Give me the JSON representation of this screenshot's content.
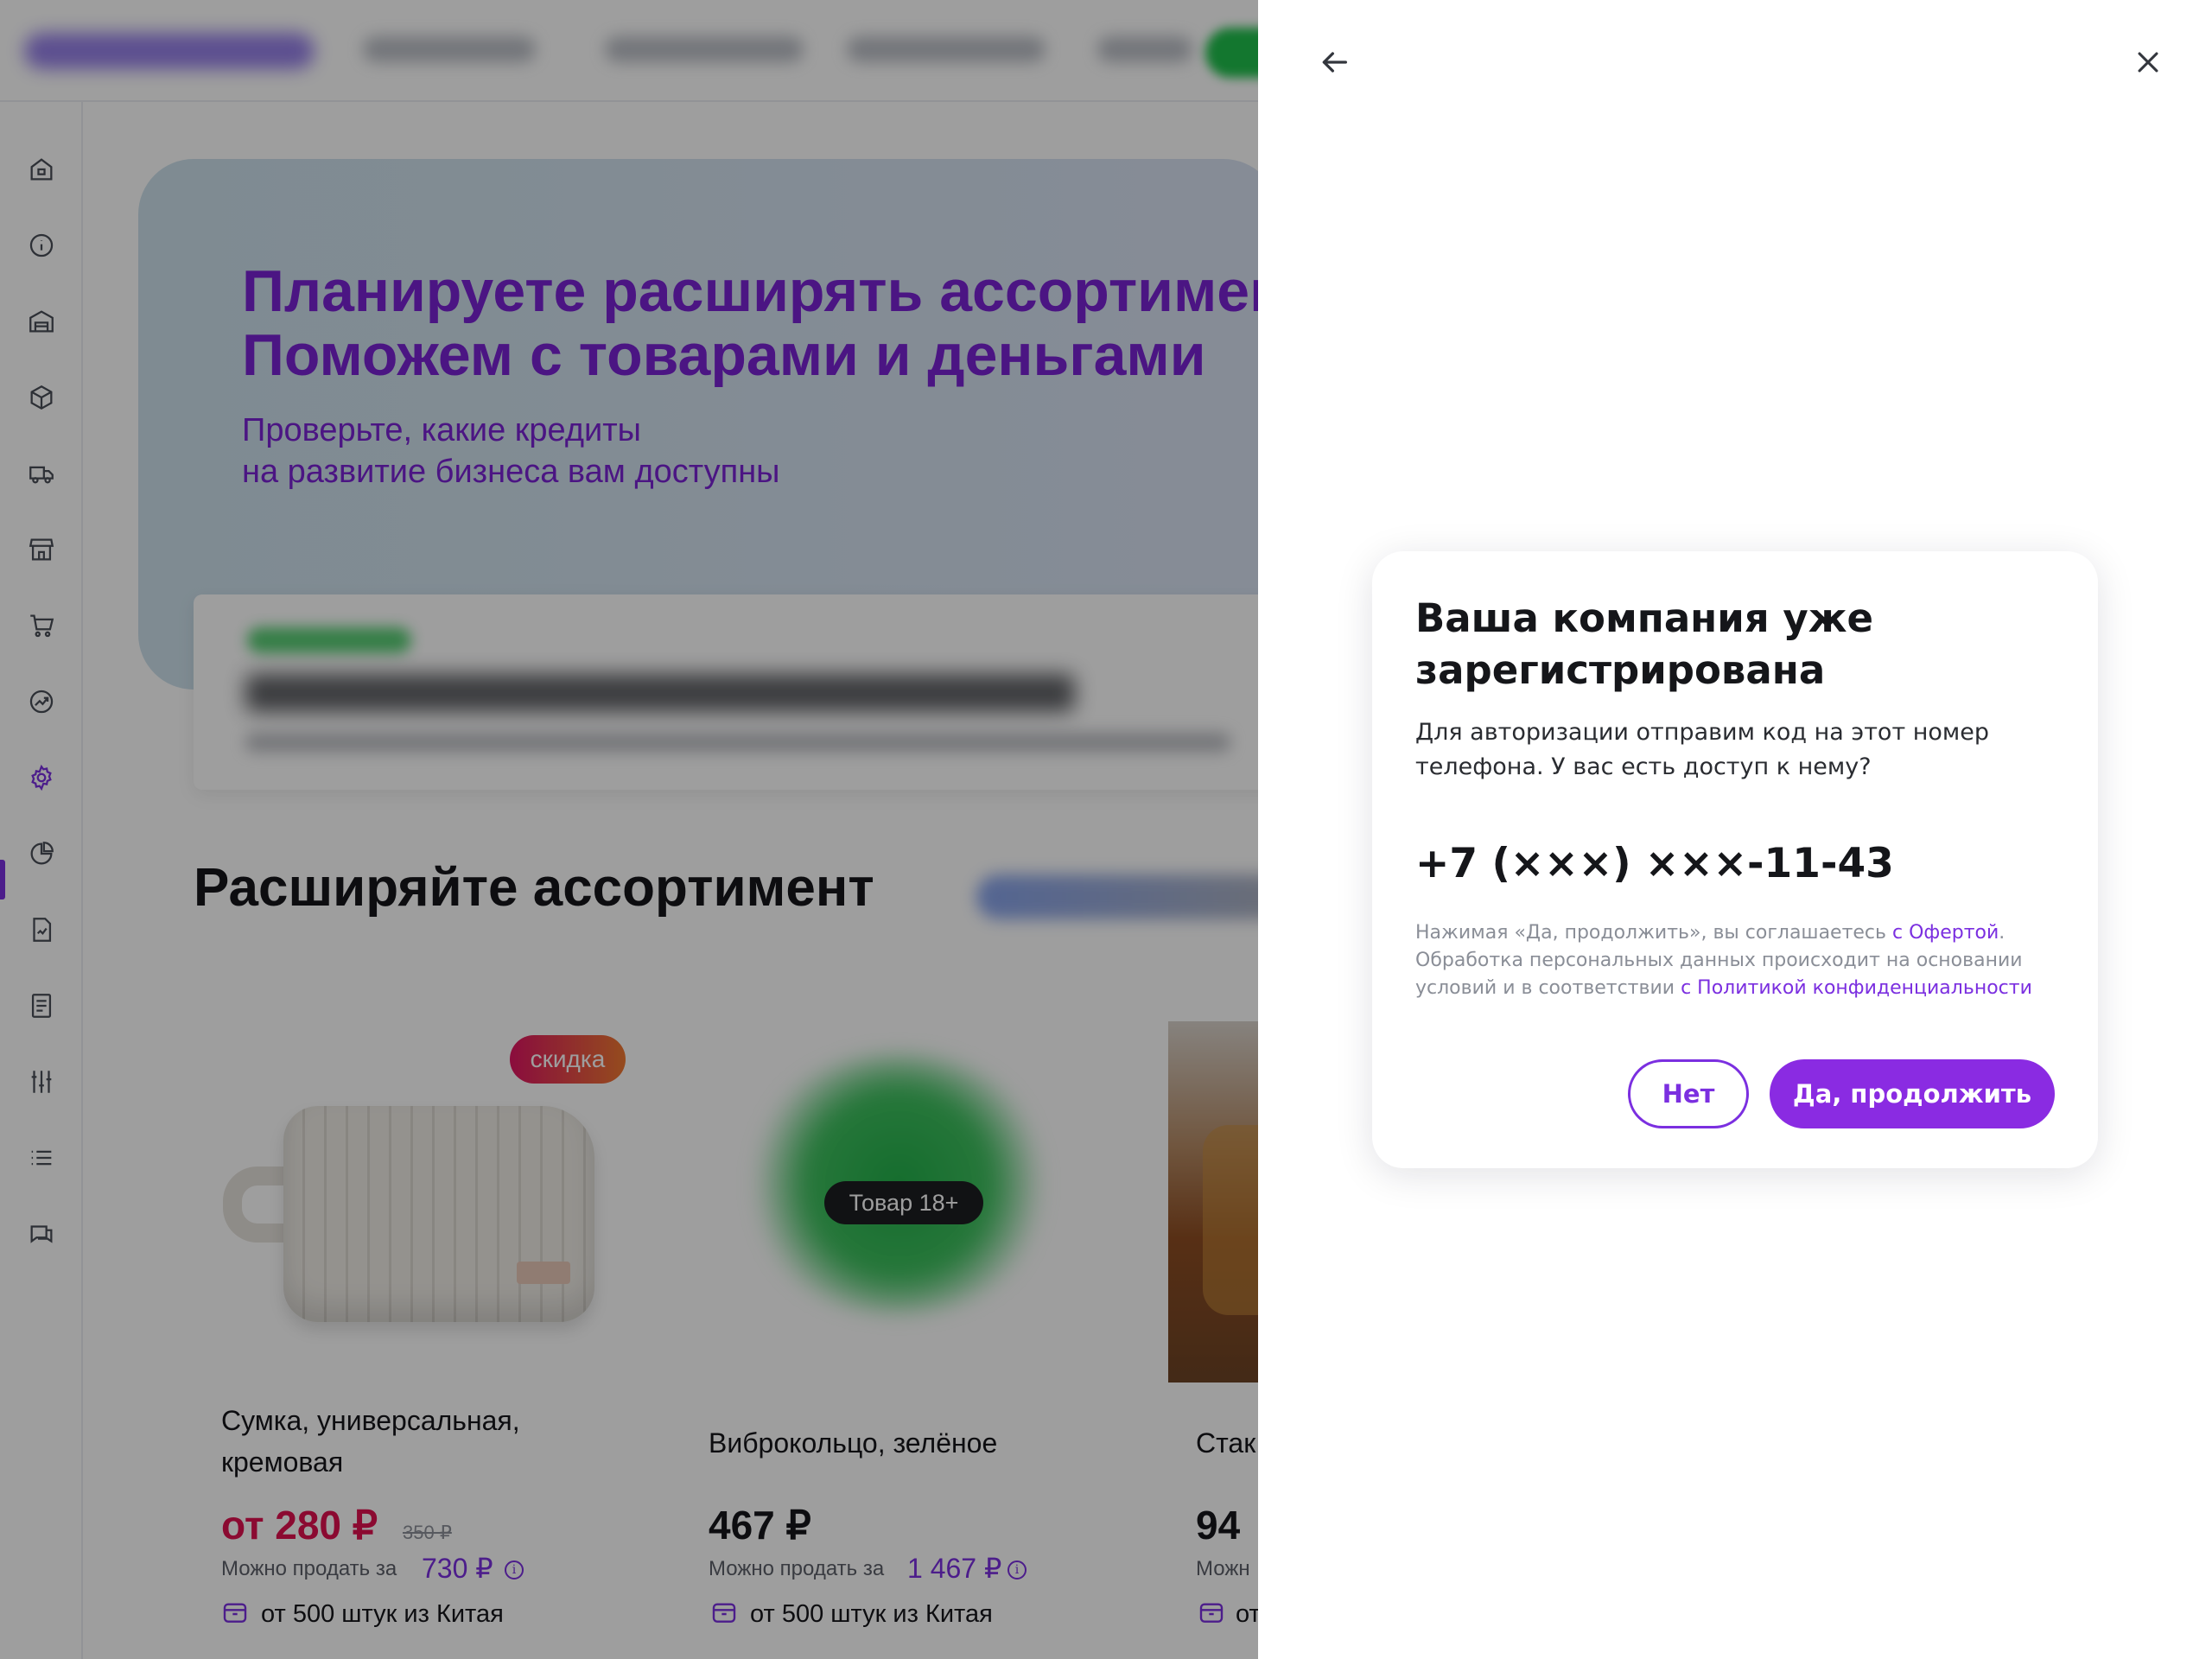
{
  "colors": {
    "accent": "#8a2be2",
    "accent_text": "#7b2fe0",
    "sale": "#e0114f",
    "overlay": "rgba(0,0,0,0.38)"
  },
  "sidebar": {
    "items": [
      {
        "icon": "home-icon"
      },
      {
        "icon": "info-icon"
      },
      {
        "icon": "warehouse-icon"
      },
      {
        "icon": "box-icon"
      },
      {
        "icon": "truck-icon"
      },
      {
        "icon": "store-icon"
      },
      {
        "icon": "cart-icon"
      },
      {
        "icon": "growth-chart-icon"
      },
      {
        "icon": "gear-icon",
        "active": true
      },
      {
        "icon": "pie-chart-icon"
      },
      {
        "icon": "report-icon"
      },
      {
        "icon": "document-icon"
      },
      {
        "icon": "sliders-icon"
      },
      {
        "icon": "list-icon"
      },
      {
        "icon": "chat-icon"
      }
    ]
  },
  "banner": {
    "title": "Планируете расширять ассортимент?\nПоможем с товарами и деньгами",
    "subtitle": "Проверьте, какие кредиты\nна развитие бизнеса вам доступны"
  },
  "section": {
    "title": "Расширяйте ассортимент"
  },
  "products": [
    {
      "badge": "скидка",
      "title": "Сумка, универсальная,\nкремовая",
      "price": "от 280 ₽",
      "old_price": "350 ₽",
      "resell_label": "Можно продать за",
      "resell_value": "730 ₽",
      "origin": "от 500 штук из Китая"
    },
    {
      "badge": "Товар 18+",
      "title": "Виброкольцо, зелёное",
      "price": "467 ₽",
      "resell_label": "Можно продать за",
      "resell_value": "1 467 ₽",
      "origin": "от 500 штук из Китая"
    },
    {
      "title": "Стак",
      "price": "94",
      "resell_label": "Можн",
      "origin": "от"
    }
  ],
  "drawer": {
    "back_icon": "arrow-left-icon",
    "close_icon": "close-icon"
  },
  "dialog": {
    "title": "Ваша компания уже\nзарегистрирована",
    "text": "Для авторизации отправим код на этот номер\nтелефона. У вас есть доступ к нему?",
    "phone": "+7 (×××) ×××-11-43",
    "legal_part1": "Нажимая «Да, продолжить», вы соглашаетесь ",
    "legal_link1": "с Офертой",
    "legal_part2": ". Обработка персональных данных происходит на основании условий и в соответствии ",
    "legal_link2": "с Политикой конфиденциальности",
    "btn_no": "Нет",
    "btn_yes": "Да, продолжить"
  }
}
